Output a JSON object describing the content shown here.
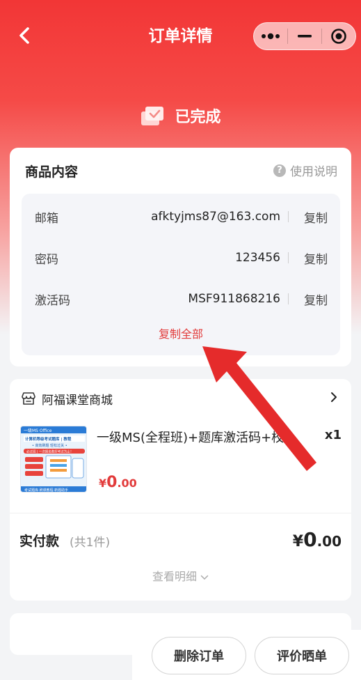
{
  "header": {
    "title": "订单详情",
    "status": "已完成"
  },
  "colors": {
    "brand_red": "#f23636",
    "price_red": "#e23b3b"
  },
  "content_card": {
    "title": "商品内容",
    "help_label": "使用说明",
    "copy_label": "复制",
    "copy_all_label": "复制全部",
    "rows": [
      {
        "label": "邮箱",
        "value": "afktyjms87@163.com"
      },
      {
        "label": "密码",
        "value": "123456"
      },
      {
        "label": "激活码",
        "value": "MSF911868216"
      }
    ]
  },
  "order_card": {
    "shop_name": "阿福课堂商城",
    "product": {
      "title": "一级MS(全程班)+题库激活码+校…",
      "quantity": "x1",
      "price_symbol": "¥",
      "price_int": "0",
      "price_dec": ".00",
      "thumb_texts": {
        "top": "一级MS Office",
        "line1": "计算机等级考试题库 | 教程",
        "line2": "• 高效刷题 轻松过关 •",
        "line3": "必过班 | 一次报名数好考过为止！",
        "footer": "考试题库·刷课教程·新题助手"
      }
    },
    "payment": {
      "label": "实付款",
      "count": "(共1件)",
      "symbol": "¥",
      "int": "0",
      "dec": ".00"
    },
    "details_label": "查看明细"
  },
  "bottom_bar": {
    "delete_label": "删除订单",
    "review_label": "评价晒单"
  }
}
